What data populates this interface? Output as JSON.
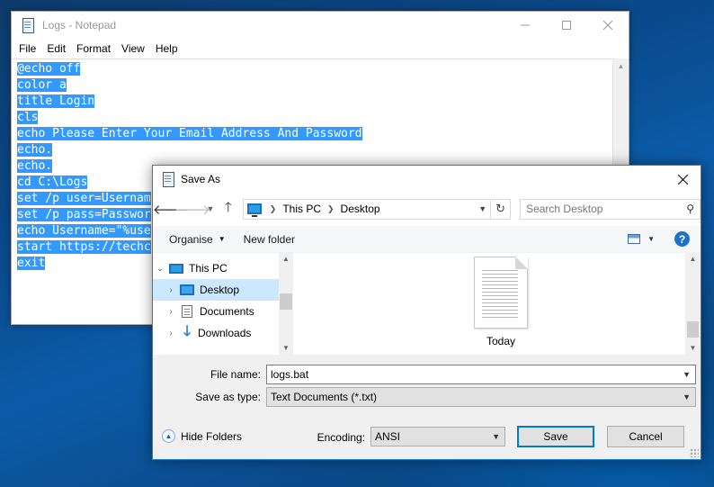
{
  "notepad": {
    "title": "Logs - Notepad",
    "menu": [
      "File",
      "Edit",
      "Format",
      "View",
      "Help"
    ],
    "lines": [
      "@echo off",
      "color a",
      "title Login",
      "cls",
      "echo Please Enter Your Email Address And Password",
      "echo.",
      "echo.",
      "cd C:\\Logs",
      "set /p user=Usernam",
      "set /p pass=Passwor",
      "echo Username=\"%use",
      "start https://techc",
      "exit"
    ]
  },
  "dialog": {
    "title": "Save As",
    "breadcrumb": [
      "This PC",
      "Desktop"
    ],
    "search_placeholder": "Search Desktop",
    "toolbar": {
      "organise": "Organise",
      "new_folder": "New folder",
      "help": "?"
    },
    "tree": [
      {
        "label": "This PC",
        "icon": "computer-icon"
      },
      {
        "label": "Desktop",
        "icon": "desktop-icon",
        "selected": true
      },
      {
        "label": "Documents",
        "icon": "documents-icon"
      },
      {
        "label": "Downloads",
        "icon": "downloads-icon"
      }
    ],
    "files": [
      {
        "label": "Today",
        "icon": "text-document-icon"
      }
    ],
    "file_name_label": "File name:",
    "file_name": "logs.bat",
    "save_type_label": "Save as type:",
    "save_type": "Text Documents (*.txt)",
    "hide_folders": "Hide Folders",
    "encoding_label": "Encoding:",
    "encoding": "ANSI",
    "save_button": "Save",
    "cancel_button": "Cancel"
  },
  "colors": {
    "selection": "#3399ff",
    "accent": "#0078d7",
    "tree_selected": "#cce8ff"
  }
}
